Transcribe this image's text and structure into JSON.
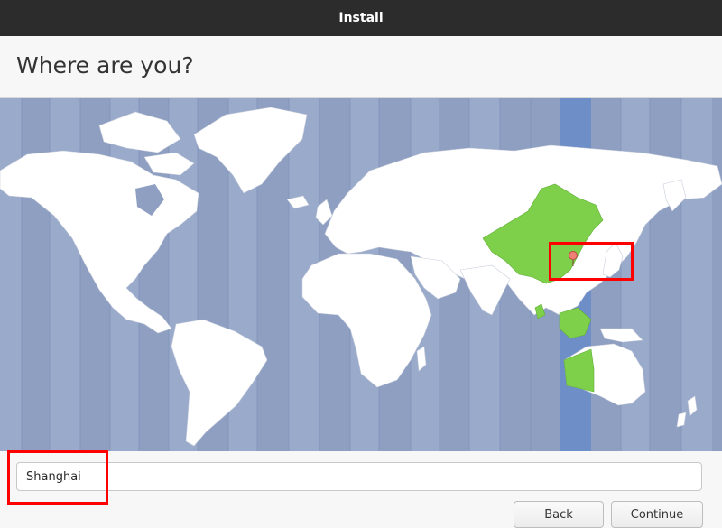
{
  "window": {
    "title": "Install"
  },
  "page": {
    "heading": "Where are you?"
  },
  "map": {
    "ocean_color": "#8e9fc2",
    "land_color": "#ffffff",
    "selected_region_color": "#7ed04b",
    "selected_zone_band_color": "#6d8ec6",
    "marker_color": "#f07f76"
  },
  "timezone": {
    "value": "Shanghai"
  },
  "buttons": {
    "back": "Back",
    "continue": "Continue"
  },
  "highlights": {
    "color": "#ff0000"
  }
}
